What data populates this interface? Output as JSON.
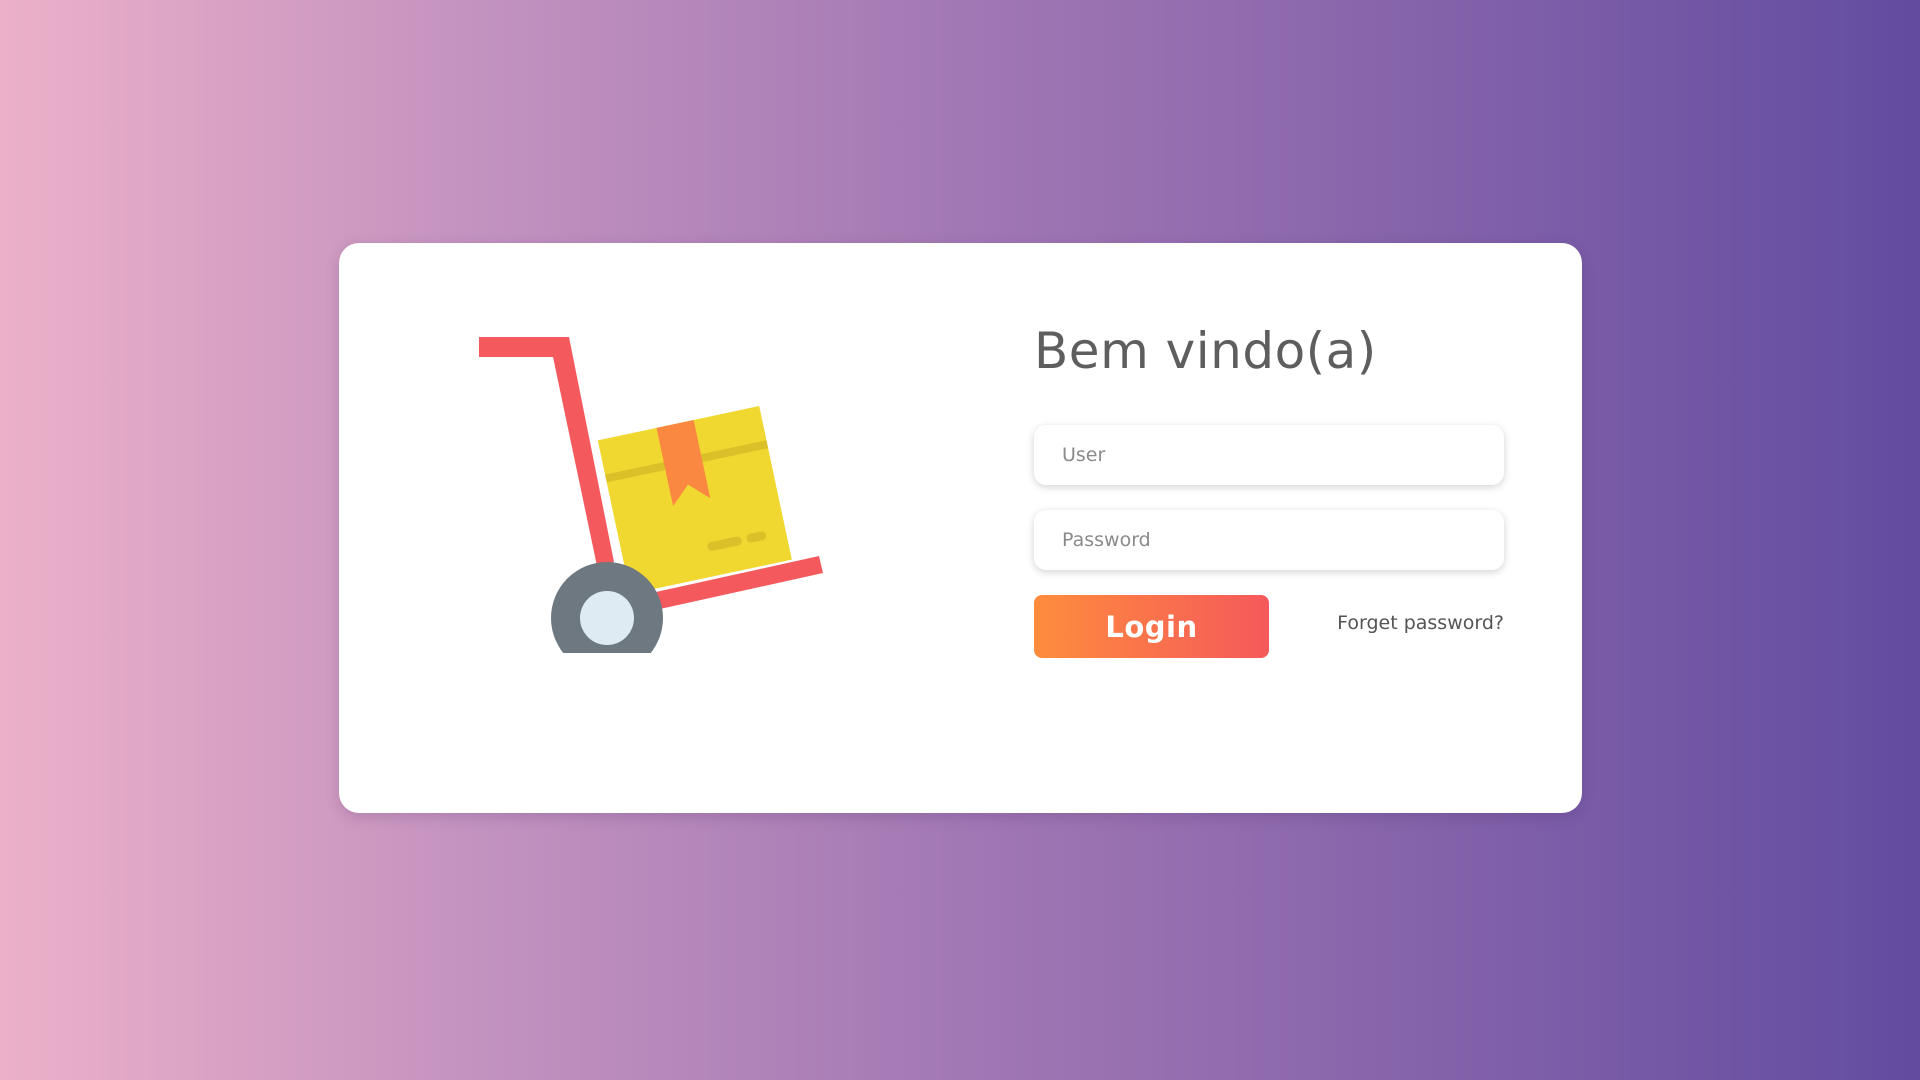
{
  "login": {
    "title": "Bem vindo(a)",
    "user_placeholder": "User",
    "password_placeholder": "Password",
    "login_label": "Login",
    "forgot_label": "Forget password?"
  },
  "illustration": {
    "icon": "hand-truck-with-box-icon"
  },
  "colors": {
    "background_start": "#ecb0c9",
    "background_end": "#624ca0",
    "button_start": "#fe8c3c",
    "button_end": "#f5595b",
    "truck_frame": "#f45a5d",
    "box": "#f0d830",
    "box_tape": "#fb8840",
    "wheel": "#6d7880",
    "wheel_hub": "#deebf2",
    "title_text": "#5e5e5e"
  }
}
